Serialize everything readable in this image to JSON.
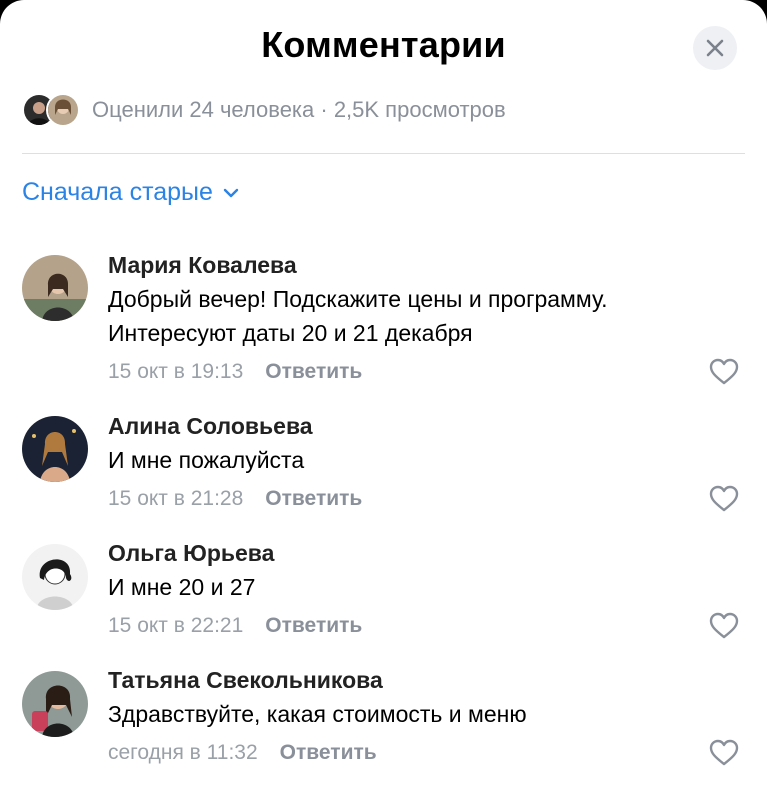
{
  "header": {
    "title": "Комментарии"
  },
  "summary": {
    "stats": "Оценили 24 человека · 2,5K просмотров"
  },
  "sort": {
    "label": "Сначала старые"
  },
  "comments": [
    {
      "author": "Мария Ковалева",
      "text": "Добрый вечер! Подскажите цены и программу. Интересуют даты 20 и 21 декабря",
      "time": "15 окт в 19:13",
      "reply": "Ответить"
    },
    {
      "author": "Алина Соловьева",
      "text": "И мне пожалуйста",
      "time": "15 окт в 21:28",
      "reply": "Ответить"
    },
    {
      "author": "Ольга Юрьева",
      "text": "И мне 20 и 27",
      "time": "15 окт в 22:21",
      "reply": "Ответить"
    },
    {
      "author": "Татьяна Свекольникова",
      "text": "Здравствуйте, какая стоимость и меню",
      "time": "сегодня в 11:32",
      "reply": "Ответить"
    }
  ],
  "colors": {
    "accent": "#2b83e5",
    "secondary": "#8a9099"
  }
}
